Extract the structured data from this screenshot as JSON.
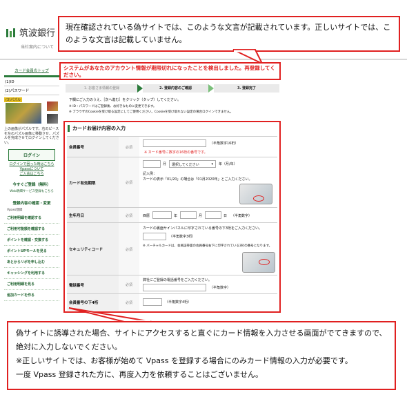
{
  "header": {
    "bank_name": "筑波銀行",
    "bank_sub": "当社案内について"
  },
  "top_callout": {
    "text": "現在確認されている偽サイトでは、このような文言が記載されています。正しいサイトでは、このような文言は記載していません。"
  },
  "alert_text": "システムがあなたのアカウント情報が期限切れになったことを検出しました。再登録してください。",
  "sidebar": {
    "top_link": "カード会員のトップ",
    "id_label": "(1)ID",
    "password_label": "(2)パスワード",
    "puzzle_label": "(3)パズル",
    "puzzle_desc": "上の画像がパズルです。右のピースを左のパズル画像に移動させ、パズルを完成させてログインしてください。",
    "login_button": "ログイン",
    "login_help_1": "ログインで困った時はこちら",
    "login_help_2": "Vpassについて",
    "login_help_3": "ご入会はこちら",
    "register_button": "今すぐご登録（無料）",
    "register_sub": "Web明細サービス登録もこちら",
    "menu_title": "登録内容の確認・変更",
    "menu_sub": "Vpass登録",
    "menu_items": [
      "ご利用明細を確認する",
      "ご利用可能額を確認する",
      "ポイントを確認・交換する",
      "ポイントUPモールを見る",
      "あとからリボを申し込む",
      "キャッシングを利用する",
      "ご利用明細を見る",
      "追加カードを作る"
    ]
  },
  "steps": [
    "1. お客さま情報の登録",
    "2. 登録内容のご確認",
    "3. 登録完了"
  ],
  "instructions": {
    "line1": "下欄にご入力のうえ、［次へ進む］をクリック（タップ）してください。",
    "line2": "※ ID・パスワードはご登録後、お好きなものに変更できます。",
    "line3": "※ ブラウザのCookieを受け取る設定にしてご使用ください。Cookieを受け取れない設定の場合ログインできません。"
  },
  "form": {
    "title": "カードお届け内容の入力",
    "required": "必須",
    "rows": [
      {
        "label": "会員番号",
        "hint": "（半角数字16桁）",
        "note": "※ カード番号に数字の16桁の番号です。"
      },
      {
        "label": "カード有効期限",
        "month_unit": "月",
        "select_placeholder": "選択してください",
        "year_unit": "年（月/年）",
        "example_title": "記入例：",
        "example_text": "カードの表示「01/20」の場合は「01月2020年」とご入力ください。"
      },
      {
        "label": "生年月日",
        "era": "西暦",
        "year_unit": "年",
        "month_unit": "月",
        "day_unit": "日",
        "hint": "（半角数字）"
      },
      {
        "label": "セキュリティコード",
        "instruction": "カードの裏面サインパネルに印字されている番号の下3桁をご入力ください。",
        "hint": "（半角数字3桁）",
        "note": "※ バーチャルカードは、会員証券面の会員番号右下に印字されている3桁の番号となります。"
      },
      {
        "label": "電話番号",
        "instruction": "弊社にご登録の電話番号をご入力ください。",
        "hint": "（半角数字）"
      },
      {
        "label": "会員番号の下4桁",
        "hint": "（半角数字4桁）"
      }
    ]
  },
  "bottom_callout": {
    "line1": "偽サイトに誘導された場合、サイトにアクセスすると直ぐにカード情報を入力させる画面がでてきますので、絶対に入力しないでください。",
    "line2": "※正しいサイトでは、お客様が始めて Vpass を登録する場合にのみカード情報の入力が必要です。",
    "line3": "一度 Vpass 登録された方に、再度入力を依頼することはございません。"
  },
  "colors": {
    "red": "#e02020",
    "green": "#2a7a3a"
  }
}
